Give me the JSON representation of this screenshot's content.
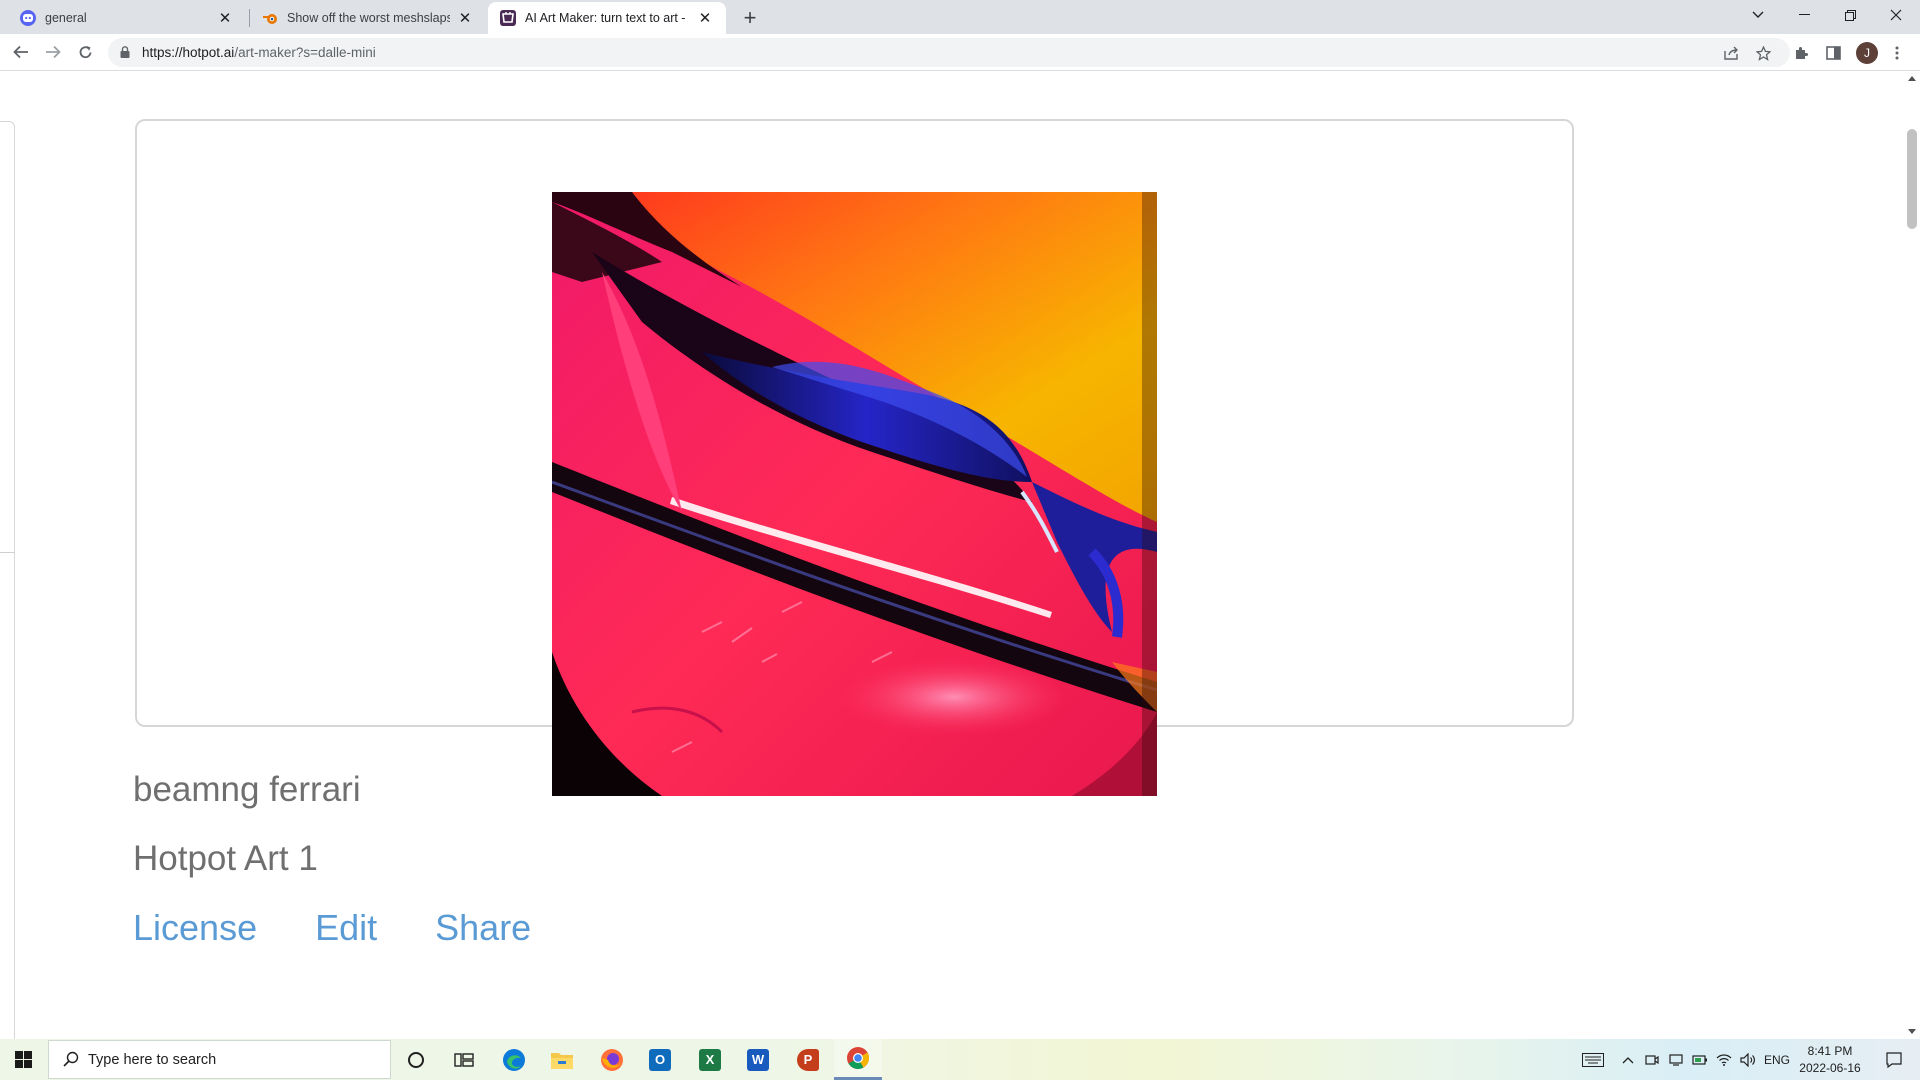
{
  "browser": {
    "tabs": [
      {
        "title": "general",
        "favicon": "discord-icon"
      },
      {
        "title": "Show off the worst meshslaps, b",
        "favicon": "blender-icon"
      },
      {
        "title": "AI Art Maker: turn text to art - Ho",
        "favicon": "hotpot-icon"
      }
    ],
    "url_host": "https://hotpot.ai",
    "url_path": "/art-maker?s=dalle-mini",
    "profile_initial": "J"
  },
  "page": {
    "prompt_text": "beamng ferrari",
    "art_name": "Hotpot Art 1",
    "links": {
      "license": "License",
      "edit": "Edit",
      "share": "Share"
    },
    "colors": {
      "link": "#5b9bd5",
      "caption": "#6f6f6f"
    }
  },
  "taskbar": {
    "search_placeholder": "Type here to search",
    "apps": [
      "cortana-icon",
      "task-view-icon",
      "edge-icon",
      "file-explorer-icon",
      "firefox-icon",
      "outlook-icon",
      "excel-icon",
      "word-icon",
      "powerpoint-icon",
      "chrome-icon"
    ],
    "language": "ENG",
    "time": "8:41 PM",
    "date": "2022-06-16"
  }
}
